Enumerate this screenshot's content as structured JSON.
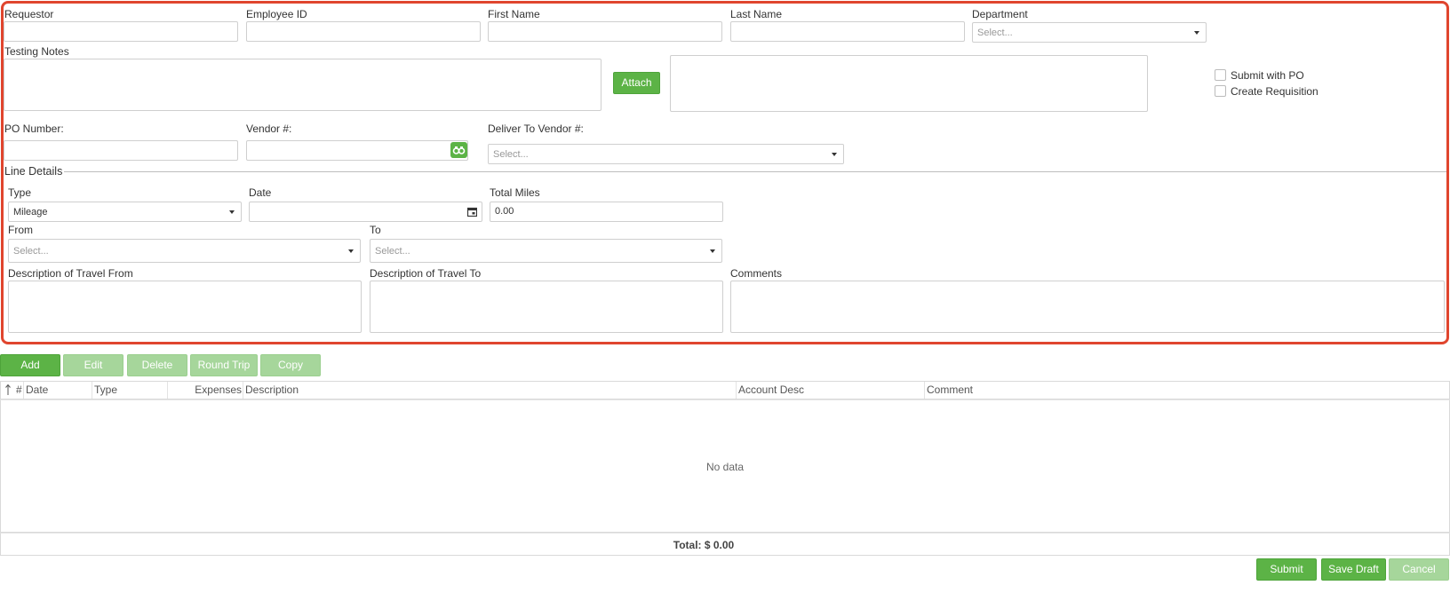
{
  "header": {
    "requestor_label": "Requestor",
    "employee_id_label": "Employee ID",
    "first_name_label": "First Name",
    "last_name_label": "Last Name",
    "department_label": "Department",
    "department_placeholder": "Select...",
    "testing_notes_label": "Testing Notes",
    "attach_label": "Attach",
    "submit_with_po_label": "Submit with PO",
    "create_requisition_label": "Create Requisition",
    "po_number_label": "PO Number:",
    "vendor_label": "Vendor #:",
    "deliver_to_vendor_label": "Deliver To Vendor #:",
    "deliver_to_vendor_placeholder": "Select..."
  },
  "line_details": {
    "legend": "Line Details",
    "type_label": "Type",
    "type_value": "Mileage",
    "date_label": "Date",
    "total_miles_label": "Total Miles",
    "total_miles_value": "0.00",
    "from_label": "From",
    "from_placeholder": "Select...",
    "to_label": "To",
    "to_placeholder": "Select...",
    "desc_from_label": "Description of Travel From",
    "desc_to_label": "Description of Travel To",
    "comments_label": "Comments"
  },
  "toolbar": {
    "add": "Add",
    "edit": "Edit",
    "delete": "Delete",
    "round_trip": "Round Trip",
    "copy": "Copy"
  },
  "grid": {
    "columns": [
      "#",
      "Date",
      "Type",
      "Expenses",
      "Description",
      "Account Desc",
      "Comment"
    ],
    "empty_text": "No data",
    "total_text": "Total: $ 0.00"
  },
  "actions": {
    "submit": "Submit",
    "save_draft": "Save Draft",
    "cancel": "Cancel"
  },
  "colors": {
    "accent_green": "#5cb346",
    "disabled_green": "#a6d69b",
    "highlight_red": "#e0452e"
  }
}
